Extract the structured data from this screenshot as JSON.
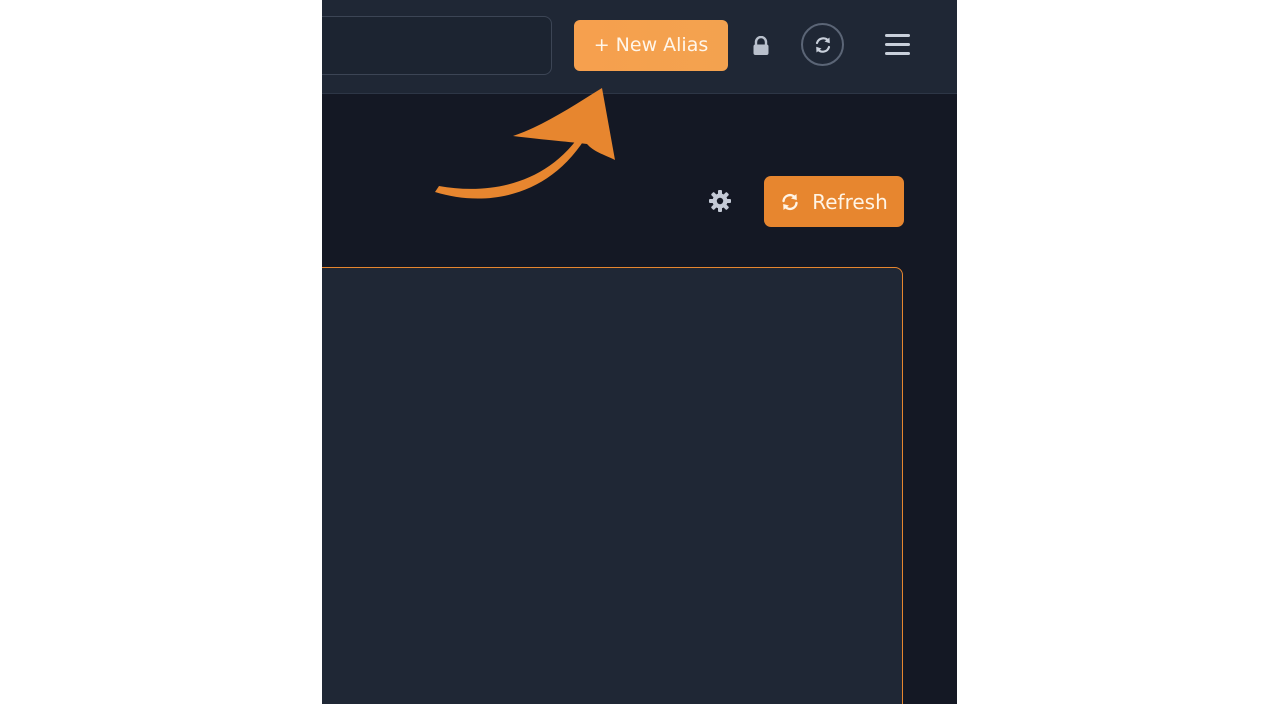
{
  "topbar": {
    "new_alias_label": "+ New Alias"
  },
  "toolbar": {
    "refresh_label": "Refresh"
  },
  "icons": {
    "lock": "lock-icon",
    "sync": "sync-icon",
    "menu": "hamburger-menu-icon",
    "settings": "gear-icon",
    "refresh": "refresh-icon",
    "annotation": "curved-arrow"
  },
  "colors": {
    "accent": "#e7862f",
    "accent_light": "#f6a04e",
    "background": "#141824",
    "panel": "#1f2735"
  }
}
